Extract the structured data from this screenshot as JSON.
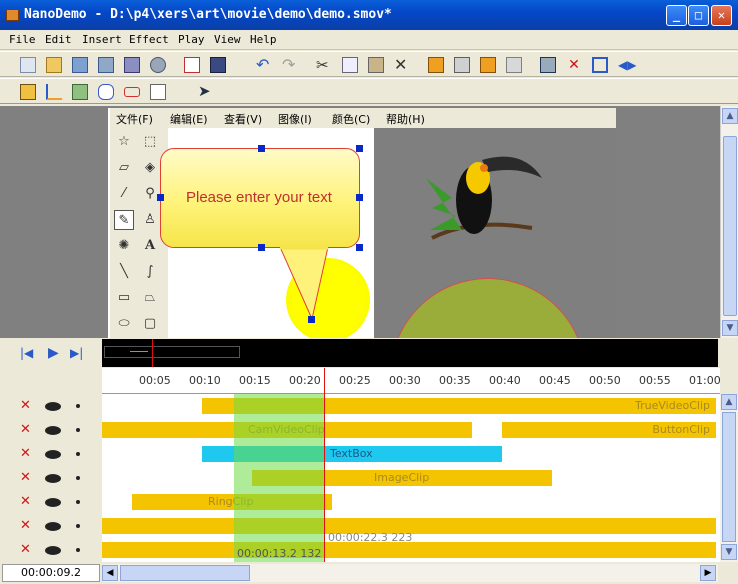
{
  "window": {
    "title": "NanoDemo - D:\\p4\\xers\\art\\movie\\demo\\demo.smov*",
    "minimize": "_",
    "maximize": "□",
    "close": "✕"
  },
  "menu": {
    "items": [
      "File",
      "Edit",
      "Insert",
      "Effect",
      "Play",
      "View",
      "Help"
    ]
  },
  "inner_menu": {
    "items": [
      "文件(F)",
      "编辑(E)",
      "查看(V)",
      "图像(I)",
      "颜色(C)",
      "帮助(H)"
    ]
  },
  "callout": {
    "text": "Please enter your text"
  },
  "ruler": {
    "ticks": [
      "00:05",
      "00:10",
      "00:15",
      "00:20",
      "00:25",
      "00:30",
      "00:35",
      "00:40",
      "00:45",
      "00:50",
      "00:55",
      "01:00"
    ]
  },
  "tracks": [
    {
      "clips": [
        {
          "label": "TrueVideoClip",
          "color": "#f5c400"
        }
      ]
    },
    {
      "clips": [
        {
          "label": "CamVideoClip",
          "color": "#f5c400"
        },
        {
          "label": "ButtonClip",
          "color": "#f5c400"
        }
      ]
    },
    {
      "clips": [
        {
          "label": "TextBox",
          "color": "#1ec8ef"
        }
      ]
    },
    {
      "clips": [
        {
          "label": "ImageClip",
          "color": "#f5c400"
        }
      ]
    },
    {
      "clips": [
        {
          "label": "RingClip",
          "color": "#f5c400"
        }
      ]
    },
    {
      "clips": [
        {
          "label": "",
          "color": "#f5c400"
        }
      ]
    },
    {
      "clips": [
        {
          "label": "",
          "color": "#f5c400"
        }
      ]
    }
  ],
  "timeline": {
    "cursor_time": "00:00:22.3  223",
    "selection_time": "00:00:13.2  132",
    "current_time": "00:00:09.2"
  },
  "colors": {
    "accent": "#0a5fd8",
    "clip_yellow": "#f5c400",
    "clip_cyan": "#1ec8ef",
    "selection_green": "#86e05a",
    "playhead_red": "#e01010"
  },
  "icons": {
    "transport": [
      "skip-start-icon",
      "play-icon",
      "skip-end-icon"
    ]
  }
}
